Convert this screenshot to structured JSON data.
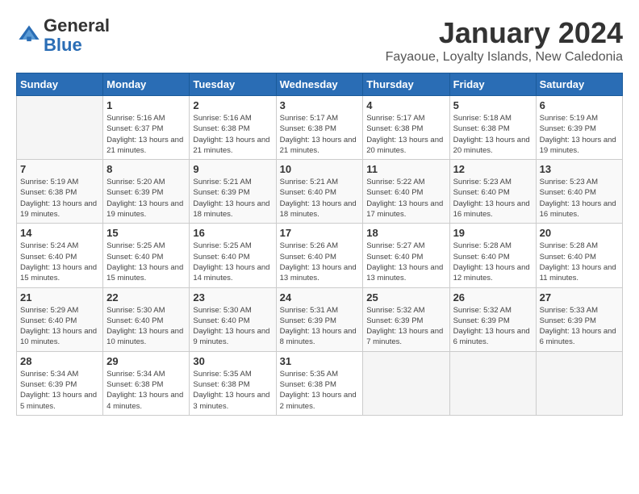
{
  "logo": {
    "general": "General",
    "blue": "Blue"
  },
  "header": {
    "month": "January 2024",
    "location": "Fayaoue, Loyalty Islands, New Caledonia"
  },
  "days_of_week": [
    "Sunday",
    "Monday",
    "Tuesday",
    "Wednesday",
    "Thursday",
    "Friday",
    "Saturday"
  ],
  "weeks": [
    [
      {
        "day": "",
        "sunrise": "",
        "sunset": "",
        "daylight": ""
      },
      {
        "day": "1",
        "sunrise": "Sunrise: 5:16 AM",
        "sunset": "Sunset: 6:37 PM",
        "daylight": "Daylight: 13 hours and 21 minutes."
      },
      {
        "day": "2",
        "sunrise": "Sunrise: 5:16 AM",
        "sunset": "Sunset: 6:38 PM",
        "daylight": "Daylight: 13 hours and 21 minutes."
      },
      {
        "day": "3",
        "sunrise": "Sunrise: 5:17 AM",
        "sunset": "Sunset: 6:38 PM",
        "daylight": "Daylight: 13 hours and 21 minutes."
      },
      {
        "day": "4",
        "sunrise": "Sunrise: 5:17 AM",
        "sunset": "Sunset: 6:38 PM",
        "daylight": "Daylight: 13 hours and 20 minutes."
      },
      {
        "day": "5",
        "sunrise": "Sunrise: 5:18 AM",
        "sunset": "Sunset: 6:38 PM",
        "daylight": "Daylight: 13 hours and 20 minutes."
      },
      {
        "day": "6",
        "sunrise": "Sunrise: 5:19 AM",
        "sunset": "Sunset: 6:39 PM",
        "daylight": "Daylight: 13 hours and 19 minutes."
      }
    ],
    [
      {
        "day": "7",
        "sunrise": "",
        "sunset": "",
        "daylight": ""
      },
      {
        "day": "8",
        "sunrise": "Sunrise: 5:20 AM",
        "sunset": "Sunset: 6:39 PM",
        "daylight": "Daylight: 13 hours and 19 minutes."
      },
      {
        "day": "9",
        "sunrise": "Sunrise: 5:21 AM",
        "sunset": "Sunset: 6:39 PM",
        "daylight": "Daylight: 13 hours and 18 minutes."
      },
      {
        "day": "10",
        "sunrise": "Sunrise: 5:21 AM",
        "sunset": "Sunset: 6:40 PM",
        "daylight": "Daylight: 13 hours and 18 minutes."
      },
      {
        "day": "11",
        "sunrise": "Sunrise: 5:22 AM",
        "sunset": "Sunset: 6:40 PM",
        "daylight": "Daylight: 13 hours and 17 minutes."
      },
      {
        "day": "12",
        "sunrise": "Sunrise: 5:23 AM",
        "sunset": "Sunset: 6:40 PM",
        "daylight": "Daylight: 13 hours and 16 minutes."
      },
      {
        "day": "13",
        "sunrise": "Sunrise: 5:23 AM",
        "sunset": "Sunset: 6:40 PM",
        "daylight": "Daylight: 13 hours and 16 minutes."
      }
    ],
    [
      {
        "day": "14",
        "sunrise": "",
        "sunset": "",
        "daylight": ""
      },
      {
        "day": "15",
        "sunrise": "Sunrise: 5:25 AM",
        "sunset": "Sunset: 6:40 PM",
        "daylight": "Daylight: 13 hours and 15 minutes."
      },
      {
        "day": "16",
        "sunrise": "Sunrise: 5:25 AM",
        "sunset": "Sunset: 6:40 PM",
        "daylight": "Daylight: 13 hours and 14 minutes."
      },
      {
        "day": "17",
        "sunrise": "Sunrise: 5:26 AM",
        "sunset": "Sunset: 6:40 PM",
        "daylight": "Daylight: 13 hours and 13 minutes."
      },
      {
        "day": "18",
        "sunrise": "Sunrise: 5:27 AM",
        "sunset": "Sunset: 6:40 PM",
        "daylight": "Daylight: 13 hours and 13 minutes."
      },
      {
        "day": "19",
        "sunrise": "Sunrise: 5:28 AM",
        "sunset": "Sunset: 6:40 PM",
        "daylight": "Daylight: 13 hours and 12 minutes."
      },
      {
        "day": "20",
        "sunrise": "Sunrise: 5:28 AM",
        "sunset": "Sunset: 6:40 PM",
        "daylight": "Daylight: 13 hours and 11 minutes."
      }
    ],
    [
      {
        "day": "21",
        "sunrise": "",
        "sunset": "",
        "daylight": ""
      },
      {
        "day": "22",
        "sunrise": "Sunrise: 5:30 AM",
        "sunset": "Sunset: 6:40 PM",
        "daylight": "Daylight: 13 hours and 10 minutes."
      },
      {
        "day": "23",
        "sunrise": "Sunrise: 5:30 AM",
        "sunset": "Sunset: 6:40 PM",
        "daylight": "Daylight: 13 hours and 9 minutes."
      },
      {
        "day": "24",
        "sunrise": "Sunrise: 5:31 AM",
        "sunset": "Sunset: 6:39 PM",
        "daylight": "Daylight: 13 hours and 8 minutes."
      },
      {
        "day": "25",
        "sunrise": "Sunrise: 5:32 AM",
        "sunset": "Sunset: 6:39 PM",
        "daylight": "Daylight: 13 hours and 7 minutes."
      },
      {
        "day": "26",
        "sunrise": "Sunrise: 5:32 AM",
        "sunset": "Sunset: 6:39 PM",
        "daylight": "Daylight: 13 hours and 6 minutes."
      },
      {
        "day": "27",
        "sunrise": "Sunrise: 5:33 AM",
        "sunset": "Sunset: 6:39 PM",
        "daylight": "Daylight: 13 hours and 6 minutes."
      }
    ],
    [
      {
        "day": "28",
        "sunrise": "Sunrise: 5:34 AM",
        "sunset": "Sunset: 6:39 PM",
        "daylight": "Daylight: 13 hours and 5 minutes."
      },
      {
        "day": "29",
        "sunrise": "Sunrise: 5:34 AM",
        "sunset": "Sunset: 6:38 PM",
        "daylight": "Daylight: 13 hours and 4 minutes."
      },
      {
        "day": "30",
        "sunrise": "Sunrise: 5:35 AM",
        "sunset": "Sunset: 6:38 PM",
        "daylight": "Daylight: 13 hours and 3 minutes."
      },
      {
        "day": "31",
        "sunrise": "Sunrise: 5:35 AM",
        "sunset": "Sunset: 6:38 PM",
        "daylight": "Daylight: 13 hours and 2 minutes."
      },
      {
        "day": "",
        "sunrise": "",
        "sunset": "",
        "daylight": ""
      },
      {
        "day": "",
        "sunrise": "",
        "sunset": "",
        "daylight": ""
      },
      {
        "day": "",
        "sunrise": "",
        "sunset": "",
        "daylight": ""
      }
    ]
  ],
  "week1_sunday": {
    "sunrise": "Sunrise: 5:19 AM",
    "sunset": "Sunset: 6:38 PM",
    "daylight": "Daylight: 13 hours and 19 minutes."
  },
  "week3_sunday": {
    "sunrise": "Sunrise: 5:24 AM",
    "sunset": "Sunset: 6:40 PM",
    "daylight": "Daylight: 13 hours and 15 minutes."
  },
  "week4_sunday": {
    "sunrise": "Sunrise: 5:29 AM",
    "sunset": "Sunset: 6:40 PM",
    "daylight": "Daylight: 13 hours and 10 minutes."
  }
}
